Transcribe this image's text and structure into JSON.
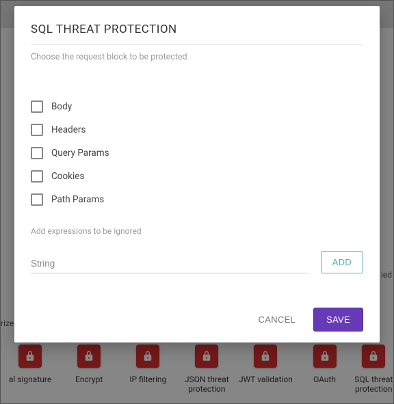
{
  "dialog": {
    "title": "SQL THREAT PROTECTION",
    "subtitle": "Choose the request block to be protected",
    "checkboxes": [
      {
        "label": "Body",
        "checked": false
      },
      {
        "label": "Headers",
        "checked": false
      },
      {
        "label": "Query Params",
        "checked": false
      },
      {
        "label": "Cookies",
        "checked": false
      },
      {
        "label": "Path Params",
        "checked": false
      }
    ],
    "ignore_label": "Add expressions to be ignored",
    "input_placeholder": "String",
    "add_label": "ADD",
    "cancel_label": "CANCEL",
    "save_label": "SAVE"
  },
  "background": {
    "policies": [
      {
        "label": "al signature"
      },
      {
        "label": "Encrypt"
      },
      {
        "label": "IP filtering"
      },
      {
        "label": "JSON threat protection"
      },
      {
        "label": "JWT validation"
      },
      {
        "label": "OAuth"
      },
      {
        "label": "SQL threat protection"
      }
    ],
    "clipped_right": "ied",
    "clipped_left": "rize"
  }
}
